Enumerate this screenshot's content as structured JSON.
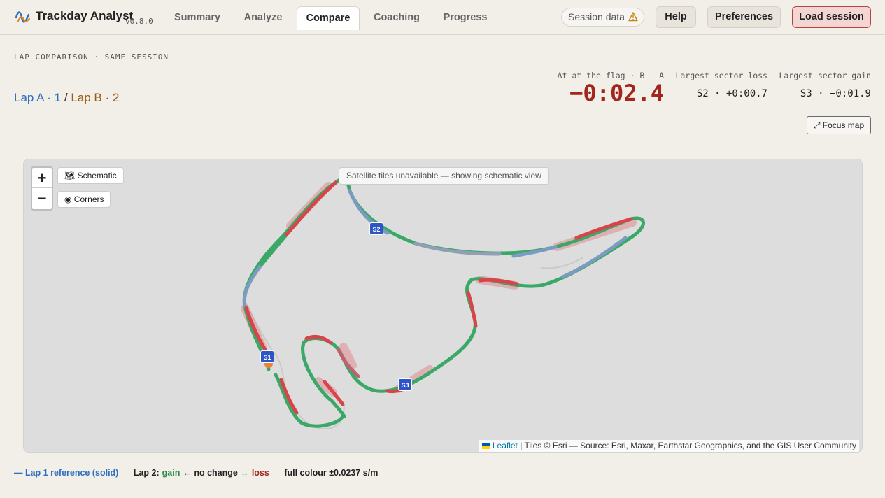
{
  "app": {
    "brand": "Trackday Analyst",
    "version": "v0.8.0"
  },
  "nav": {
    "tabs": [
      {
        "label": "Summary"
      },
      {
        "label": "Analyze"
      },
      {
        "label": "Compare"
      },
      {
        "label": "Coaching"
      },
      {
        "label": "Progress"
      }
    ],
    "active_tab": "Compare"
  },
  "header_actions": {
    "session_status": "Session data",
    "help": "Help",
    "preferences": "Preferences",
    "load_session": "Load session"
  },
  "comparison": {
    "eyebrow": "LAP COMPARISON · SAME SESSION",
    "lap_a": "Lap A · 1",
    "separator": "/",
    "lap_b": "Lap B · 2",
    "delta_label": "Δt at the flag · B − A",
    "delta_value": "−0:02.4",
    "loss_label": "Largest sector loss",
    "loss_value": "S2 · +0:00.7",
    "gain_label": "Largest sector gain",
    "gain_value": "S3 · −0:01.9",
    "focus_map": "⤢ Focus map"
  },
  "map": {
    "zoom_in": "+",
    "zoom_out": "−",
    "schematic_label": "🗺 Schematic",
    "corners_label": "◉ Corners",
    "notice": "Satellite tiles unavailable — showing schematic view",
    "sector_markers": [
      "S1",
      "S2",
      "S3"
    ],
    "attribution_leaflet": "Leaflet",
    "attribution_rest": " | Tiles © Esri — Source: Esri, Maxar, Earthstar Geographics, and the GIS User Community",
    "colors": {
      "gain": "#3aa866",
      "loss": "#d9444a",
      "neutral": "#7b9cc0",
      "reference": "#c8c8c8",
      "sector_marker": "#2e55c8"
    }
  },
  "legend": {
    "reference": "— Lap 1 reference (solid)",
    "lap2_prefix": "Lap 2:",
    "gain": "gain",
    "middle": "← no change →",
    "loss": "loss",
    "scale": "full colour ±0.0237 s/m"
  }
}
